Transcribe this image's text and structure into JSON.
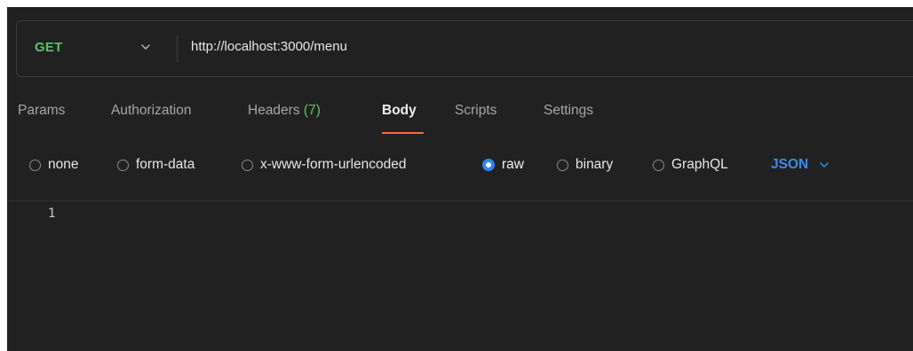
{
  "request": {
    "method": "GET",
    "url": "http://localhost:3000/menu",
    "method_chevron_icon": "chevron-down-icon"
  },
  "tabs": [
    {
      "label": "Params",
      "count": "",
      "active": false
    },
    {
      "label": "Authorization",
      "count": "",
      "active": false
    },
    {
      "label": "Headers",
      "count": "(7)",
      "active": false
    },
    {
      "label": "Body",
      "count": "",
      "active": true
    },
    {
      "label": "Scripts",
      "count": "",
      "active": false
    },
    {
      "label": "Settings",
      "count": "",
      "active": false
    }
  ],
  "body_types": [
    {
      "label": "none",
      "selected": false
    },
    {
      "label": "form-data",
      "selected": false
    },
    {
      "label": "x-www-form-urlencoded",
      "selected": false
    },
    {
      "label": "raw",
      "selected": true
    },
    {
      "label": "binary",
      "selected": false
    },
    {
      "label": "GraphQL",
      "selected": false
    }
  ],
  "format": {
    "label": "JSON",
    "chevron_icon": "chevron-down-icon"
  },
  "editor": {
    "line_numbers": [
      "1"
    ]
  },
  "colors": {
    "background": "#212121",
    "method_green": "#5fc06c",
    "accent_orange": "#f06b3a",
    "accent_blue": "#3d8bf0",
    "radio_blue": "#2e86f2"
  }
}
